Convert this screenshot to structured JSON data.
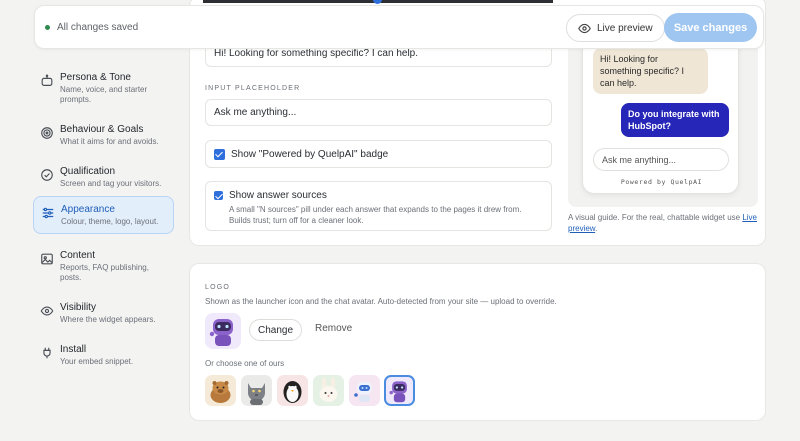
{
  "savebar": {
    "status": "All changes saved",
    "live_preview": "Live preview",
    "save": "Save changes"
  },
  "sidebar": {
    "items": [
      {
        "title": "Persona & Tone",
        "subtitle": "Name, voice, and starter prompts.",
        "icon": "robot-icon"
      },
      {
        "title": "Behaviour & Goals",
        "subtitle": "What it aims for and avoids.",
        "icon": "target-icon"
      },
      {
        "title": "Qualification",
        "subtitle": "Screen and tag your visitors.",
        "icon": "check-circle-icon"
      },
      {
        "title": "Appearance",
        "subtitle": "Colour, theme, logo, layout.",
        "icon": "sliders-icon",
        "active": true
      },
      {
        "title": "Content",
        "subtitle": "Reports, FAQ publishing, posts.",
        "icon": "image-icon"
      },
      {
        "title": "Visibility",
        "subtitle": "Where the widget appears.",
        "icon": "eye-icon"
      },
      {
        "title": "Install",
        "subtitle": "Your embed snippet.",
        "icon": "plug-icon"
      }
    ]
  },
  "form": {
    "greeting_value": "Hi! Looking for something specific? I can help.",
    "placeholder_label": "INPUT PLACEHOLDER",
    "placeholder_value": "Ask me anything...",
    "powered_badge_label": "Show \"Powered by QuelpAI\" badge",
    "powered_badge_checked": true,
    "sources_label": "Show answer sources",
    "sources_desc": "A small \"N sources\" pill under each answer that expands to the pages it drew from. Builds trust; turn off for a cleaner look.",
    "sources_checked": true
  },
  "preview": {
    "bot_message": "Hi! Looking for something specific? I can help.",
    "user_message": "Do you integrate with HubSpot?",
    "input_placeholder": "Ask me anything...",
    "powered_by": "Powered by QuelpAI",
    "note_text": "A visual guide. For the real, chattable widget use ",
    "note_link": "Live preview",
    "note_end": "."
  },
  "logo": {
    "label": "LOGO",
    "description": "Shown as the launcher icon and the chat avatar. Auto-detected from your site — upload to override.",
    "change": "Change",
    "remove": "Remove",
    "choose_label": "Or choose one of ours",
    "options": [
      "capybara-avatar",
      "cat-avatar",
      "penguin-avatar",
      "bunny-avatar",
      "blue-robot-avatar",
      "purple-robot-avatar"
    ],
    "selected_option": 5
  },
  "colors": {
    "accent": "#2f6fdc",
    "save_button": "#9fc6f1",
    "user_bubble": "#2626b8",
    "bot_bubble": "#efe6d6",
    "active_nav_bg": "#e3eefb"
  }
}
